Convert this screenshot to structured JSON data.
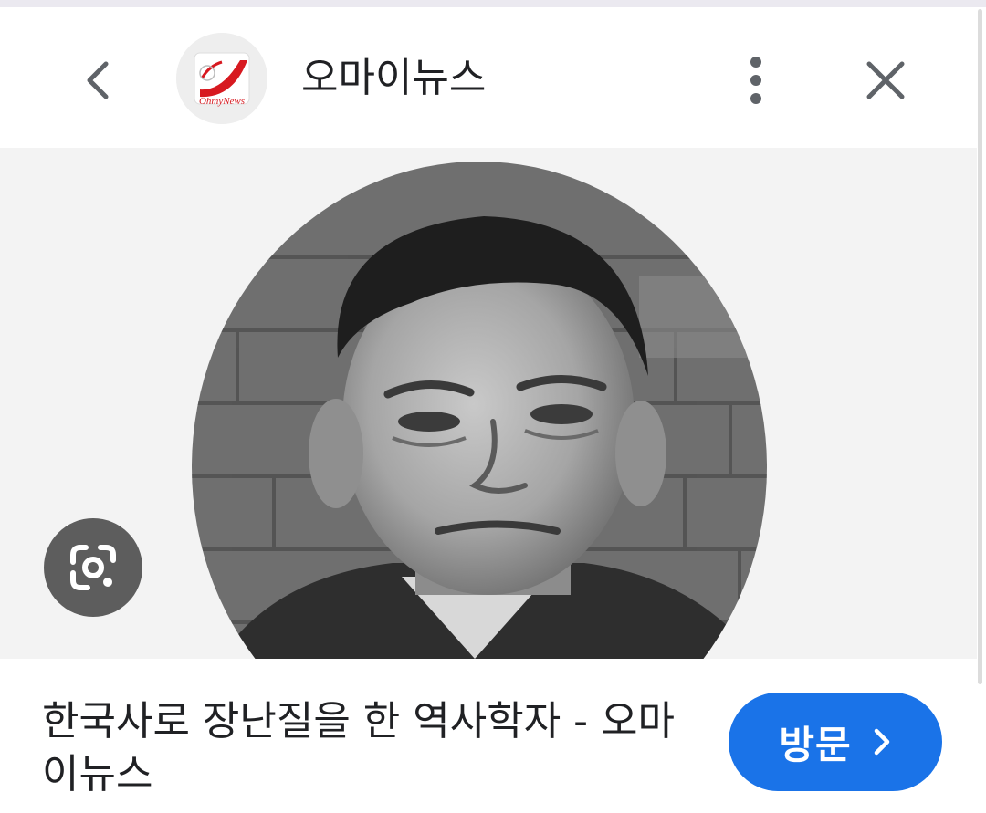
{
  "header": {
    "site_name": "오마이뉴스",
    "logo_text": "OhmyNews",
    "back_icon": "chevron-left-icon",
    "more_icon": "more-vert-icon",
    "close_icon": "close-icon"
  },
  "result": {
    "image_alt": "black and white portrait photo of a man",
    "lens_icon": "google-lens-icon",
    "title": "한국사로 장난질을 한 역사학자 - 오마이뉴스",
    "visit_label": "방문",
    "visit_icon": "chevron-right-icon"
  },
  "colors": {
    "accent": "#1a73e8",
    "logo_red": "#d71920",
    "text": "#202124",
    "image_bg": "#f3f3f3"
  }
}
